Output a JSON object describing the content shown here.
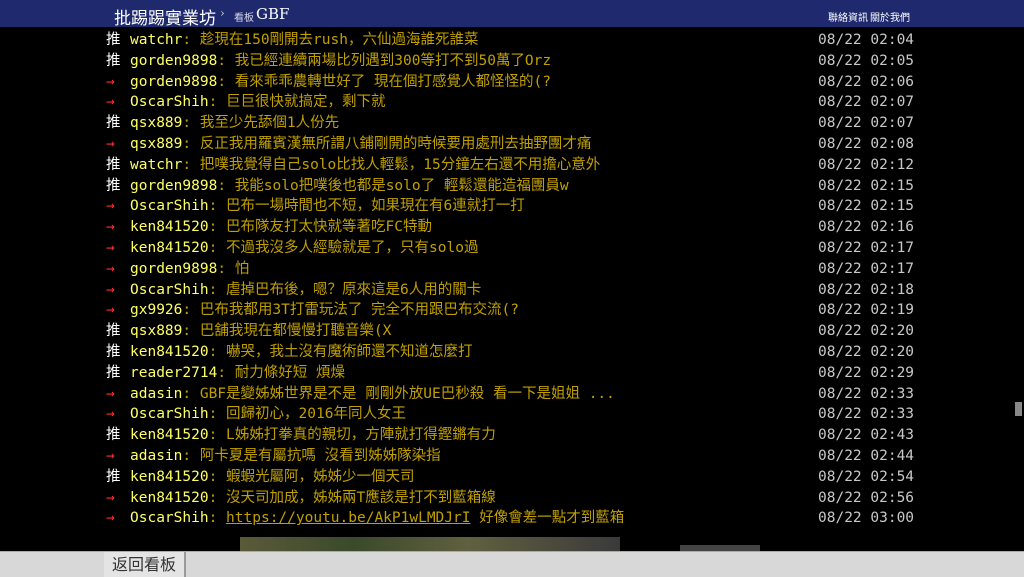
{
  "header": {
    "site_title": "批踢踢實業坊",
    "separator": "›",
    "board_label": "看板",
    "board_name": "GBF",
    "contact_link": "聯絡資訊",
    "about_link": "關於我們"
  },
  "comments": [
    {
      "tag": "推",
      "user": "watchr",
      "text": "趁現在150剛開去rush，六仙過海誰死誰菜",
      "time": "08/22 02:04"
    },
    {
      "tag": "推",
      "user": "gorden9898",
      "text": "我已經連續兩場比列遇到300等打不到50萬了Orz",
      "time": "08/22 02:05"
    },
    {
      "tag": "→",
      "user": "gorden9898",
      "text": "看來乖乖農轉世好了 現在個打感覺人都怪怪的(?",
      "time": "08/22 02:06"
    },
    {
      "tag": "→",
      "user": "OscarShih",
      "text": "巨巨很快就搞定，剩下就",
      "time": "08/22 02:07"
    },
    {
      "tag": "推",
      "user": "qsx889",
      "text": "我至少先舔個1人份先",
      "time": "08/22 02:07"
    },
    {
      "tag": "→",
      "user": "qsx889",
      "text": "反正我用羅賓漢無所謂八鋪剛開的時候要用處刑去抽野團才痛",
      "time": "08/22 02:08"
    },
    {
      "tag": "推",
      "user": "watchr",
      "text": "把噗我覺得自己solo比找人輕鬆，15分鐘左右還不用擔心意外",
      "time": "08/22 02:12"
    },
    {
      "tag": "推",
      "user": "gorden9898",
      "text": "我能solo把噗後也都是solo了 輕鬆還能造福團員w",
      "time": "08/22 02:15"
    },
    {
      "tag": "→",
      "user": "OscarShih",
      "text": "巴布一場時間也不短，如果現在有6連就打一打",
      "time": "08/22 02:15"
    },
    {
      "tag": "→",
      "user": "ken841520",
      "text": "巴布隊友打太快就等著吃FC特動",
      "time": "08/22 02:16"
    },
    {
      "tag": "→",
      "user": "ken841520",
      "text": "不過我沒多人經驗就是了，只有solo過",
      "time": "08/22 02:17"
    },
    {
      "tag": "→",
      "user": "gorden9898",
      "text": "怕",
      "time": "08/22 02:17"
    },
    {
      "tag": "→",
      "user": "OscarShih",
      "text": "虐掉巴布後，嗯？原來這是6人用的關卡",
      "time": "08/22 02:18"
    },
    {
      "tag": "→",
      "user": "gx9926",
      "text": "巴布我都用3T打雷玩法了 完全不用跟巴布交流(?",
      "time": "08/22 02:19"
    },
    {
      "tag": "推",
      "user": "qsx889",
      "text": "巴舖我現在都慢慢打聽音樂(X",
      "time": "08/22 02:20"
    },
    {
      "tag": "推",
      "user": "ken841520",
      "text": "嚇哭，我土沒有魔術師還不知道怎麼打",
      "time": "08/22 02:20"
    },
    {
      "tag": "推",
      "user": "reader2714",
      "text": "耐力條好短 煩燥",
      "time": "08/22 02:29"
    },
    {
      "tag": "→",
      "user": "adasin",
      "text": "GBF是變姊姊世界是不是 剛剛外放UE巴秒殺 看一下是姐姐 ...",
      "time": "08/22 02:33"
    },
    {
      "tag": "→",
      "user": "OscarShih",
      "text": "回歸初心，2016年同人女王",
      "time": "08/22 02:33"
    },
    {
      "tag": "推",
      "user": "ken841520",
      "text": "L姊姊打拳真的親切，方陣就打得鏗鏘有力",
      "time": "08/22 02:43"
    },
    {
      "tag": "→",
      "user": "adasin",
      "text": "阿卡夏是有屬抗嗎 沒看到姊姊隊染指",
      "time": "08/22 02:44"
    },
    {
      "tag": "推",
      "user": "ken841520",
      "text": "蝦蝦光屬阿，姊姊少一個天司",
      "time": "08/22 02:54"
    },
    {
      "tag": "→",
      "user": "ken841520",
      "text": "沒天司加成，姊姊兩T應該是打不到藍箱線",
      "time": "08/22 02:56"
    },
    {
      "tag": "→",
      "user": "OscarShih",
      "link": "https://youtu.be/AkP1wLMDJrI",
      "text": " 好像會差一點才到藍箱",
      "time": "08/22 03:00"
    }
  ],
  "footer": {
    "back_button": "返回看板"
  }
}
